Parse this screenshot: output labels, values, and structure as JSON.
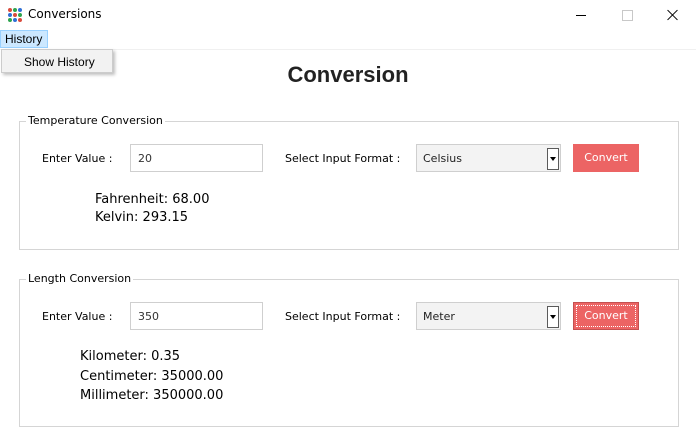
{
  "window": {
    "title": "Conversions",
    "icon": "app-dots-icon",
    "icon_colors": [
      "#d94b3d",
      "#2da44e",
      "#2f6fd6"
    ]
  },
  "menu": {
    "history_label": "History",
    "dropdown_items": [
      {
        "label": "Show History"
      }
    ]
  },
  "page_title": "Conversion",
  "temperature": {
    "legend": "Temperature Conversion",
    "enter_value_label": "Enter Value :",
    "input_value": "20",
    "select_format_label": "Select Input Format :",
    "selected_format": "Celsius",
    "convert_label": "Convert",
    "results": [
      "Fahrenheit: 68.00",
      "Kelvin: 293.15"
    ]
  },
  "length": {
    "legend": "Length Conversion",
    "enter_value_label": "Enter Value :",
    "input_value": "350",
    "select_format_label": "Select Input Format :",
    "selected_format": "Meter",
    "convert_label": "Convert",
    "results": [
      "Kilometer: 0.35",
      "Centimeter: 35000.00",
      "Millimeter: 350000.00"
    ]
  },
  "colors": {
    "accent_button": "#ec6464",
    "menu_highlight": "#cce8ff"
  }
}
